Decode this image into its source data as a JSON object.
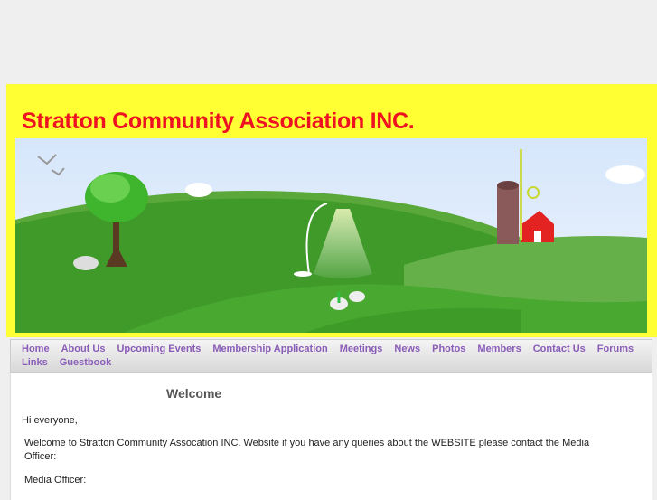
{
  "site": {
    "title": "Stratton Community Association INC."
  },
  "nav": {
    "items": [
      "Home",
      "About Us",
      "Upcoming Events",
      "Membership Application",
      "Meetings",
      "News",
      "Photos",
      "Members",
      "Contact Us",
      "Forums",
      "Links",
      "Guestbook"
    ]
  },
  "content": {
    "heading": "Welcome",
    "greeting": "Hi everyone,",
    "intro": "Welcome to Stratton Community Assocation INC. Website if you have any queries about the WEBSITE please contact the Media Officer:",
    "media_officer": "Media Officer:"
  },
  "colors": {
    "header_bg": "#ffff33",
    "title": "#ee1122",
    "nav_link": "#8a5cb8"
  }
}
